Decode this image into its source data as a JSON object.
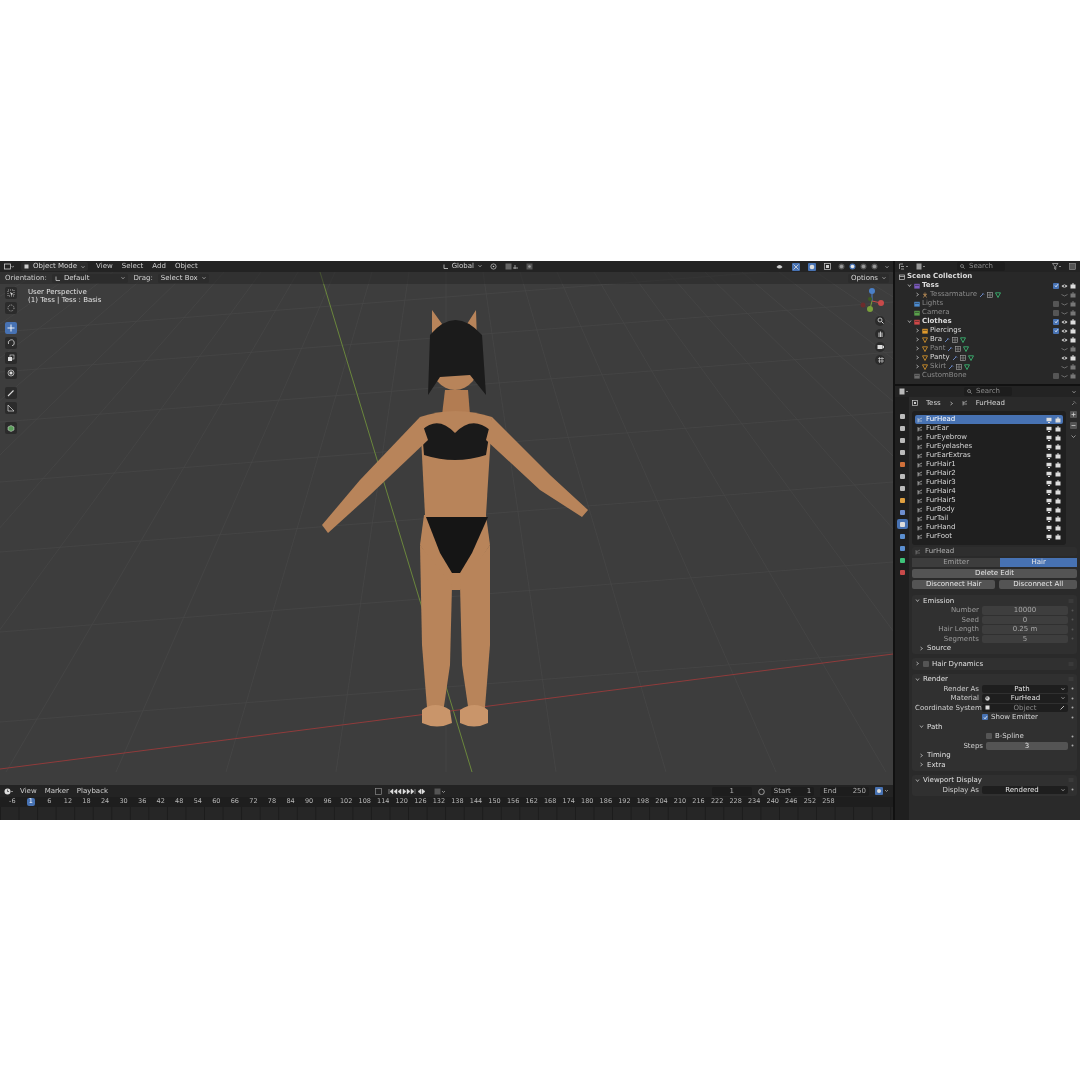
{
  "viewport": {
    "header": {
      "mode": "Object Mode",
      "menus": [
        "View",
        "Select",
        "Add",
        "Object"
      ],
      "orientation": "Global"
    },
    "tool_settings": {
      "orientation_label": "Orientation:",
      "orientation": "Default",
      "drag_label": "Drag:",
      "drag": "Select Box",
      "options": "Options"
    },
    "overlay_text": [
      "User Perspective",
      "(1) Tess | Tess : Basis"
    ],
    "tools": [
      {
        "selected": false
      },
      {
        "selected": false
      },
      {
        "selected": true
      },
      {
        "selected": false
      },
      {
        "selected": false
      },
      {
        "selected": false
      },
      {
        "selected": false
      },
      {
        "selected": false
      },
      {
        "selected": false
      }
    ],
    "shading_modes": [
      {
        "selected": false
      },
      {
        "selected": true
      },
      {
        "selected": false
      },
      {
        "selected": false
      }
    ]
  },
  "timeline": {
    "menus": [
      "View",
      "Marker",
      "Playback"
    ],
    "current_frame": "1",
    "start_label": "Start",
    "start": "1",
    "end_label": "End",
    "end": "250",
    "ruler": [
      {
        "label": "-6",
        "selected": false
      },
      {
        "label": "1",
        "selected": true
      },
      {
        "label": "6",
        "selected": false
      },
      {
        "label": "12",
        "selected": false
      },
      {
        "label": "18",
        "selected": false
      },
      {
        "label": "24",
        "selected": false
      },
      {
        "label": "30",
        "selected": false
      },
      {
        "label": "36",
        "selected": false
      },
      {
        "label": "42",
        "selected": false
      },
      {
        "label": "48",
        "selected": false
      },
      {
        "label": "54",
        "selected": false
      },
      {
        "label": "60",
        "selected": false
      },
      {
        "label": "66",
        "selected": false
      },
      {
        "label": "72",
        "selected": false
      },
      {
        "label": "78",
        "selected": false
      },
      {
        "label": "84",
        "selected": false
      },
      {
        "label": "90",
        "selected": false
      },
      {
        "label": "96",
        "selected": false
      },
      {
        "label": "102",
        "selected": false
      },
      {
        "label": "108",
        "selected": false
      },
      {
        "label": "114",
        "selected": false
      },
      {
        "label": "120",
        "selected": false
      },
      {
        "label": "126",
        "selected": false
      },
      {
        "label": "132",
        "selected": false
      },
      {
        "label": "138",
        "selected": false
      },
      {
        "label": "144",
        "selected": false
      },
      {
        "label": "150",
        "selected": false
      },
      {
        "label": "156",
        "selected": false
      },
      {
        "label": "162",
        "selected": false
      },
      {
        "label": "168",
        "selected": false
      },
      {
        "label": "174",
        "selected": false
      },
      {
        "label": "180",
        "selected": false
      },
      {
        "label": "186",
        "selected": false
      },
      {
        "label": "192",
        "selected": false
      },
      {
        "label": "198",
        "selected": false
      },
      {
        "label": "204",
        "selected": false
      },
      {
        "label": "210",
        "selected": false
      },
      {
        "label": "216",
        "selected": false
      },
      {
        "label": "222",
        "selected": false
      },
      {
        "label": "228",
        "selected": false
      },
      {
        "label": "234",
        "selected": false
      },
      {
        "label": "240",
        "selected": false
      },
      {
        "label": "246",
        "selected": false
      },
      {
        "label": "252",
        "selected": false
      },
      {
        "label": "258",
        "selected": false
      }
    ]
  },
  "outliner": {
    "search_placeholder": "Search",
    "items": [
      {
        "label": "Scene Collection",
        "kind": "scene",
        "children": [
          {
            "label": "Tess",
            "kind": "collection",
            "color": "#7d5bbf",
            "expanded": true,
            "checked": true,
            "visible": true,
            "children": [
              {
                "label": "Tessarmature",
                "kind": "armature",
                "expanded": false,
                "visible": false
              }
            ]
          },
          {
            "label": "Lights",
            "kind": "collection",
            "color": "#4c8cd1",
            "checked": false,
            "visible": false
          },
          {
            "label": "Camera",
            "kind": "collection",
            "color": "#5aa14b",
            "checked": false,
            "visible": false
          },
          {
            "label": "Clothes",
            "kind": "collection",
            "color": "#d04848",
            "expanded": true,
            "checked": true,
            "visible": true,
            "children": [
              {
                "label": "Piercings",
                "kind": "collection",
                "color": "#e09a2c",
                "expanded": false,
                "checked": true,
                "visible": true
              },
              {
                "label": "Bra",
                "kind": "mesh",
                "expanded": false,
                "visible": true
              },
              {
                "label": "Pant",
                "kind": "mesh",
                "expanded": false,
                "visible": false
              },
              {
                "label": "Panty",
                "kind": "mesh",
                "expanded": false,
                "visible": true
              },
              {
                "label": "Skirt",
                "kind": "mesh",
                "expanded": false,
                "visible": false
              }
            ]
          },
          {
            "label": "CustomBone",
            "kind": "collection",
            "color": "#6b6b6b",
            "checked": false,
            "visible": false
          }
        ]
      }
    ]
  },
  "properties": {
    "search_placeholder": "Search",
    "breadcrumb": [
      "Tess",
      "FurHead"
    ],
    "tabs": [
      {
        "selected": false
      },
      {
        "selected": false
      },
      {
        "selected": false
      },
      {
        "selected": false
      },
      {
        "selected": false
      },
      {
        "selected": false
      },
      {
        "selected": false
      },
      {
        "selected": false
      },
      {
        "selected": false
      },
      {
        "selected": true
      },
      {
        "selected": false
      },
      {
        "selected": false
      },
      {
        "selected": false
      },
      {
        "selected": false
      }
    ],
    "particle_systems": [
      {
        "label": "FurHead",
        "selected": true
      },
      {
        "label": "FurEar",
        "selected": false
      },
      {
        "label": "FurEyebrow",
        "selected": false
      },
      {
        "label": "FurEyelashes",
        "selected": false
      },
      {
        "label": "FurEarExtras",
        "selected": false
      },
      {
        "label": "FurHair1",
        "selected": false
      },
      {
        "label": "FurHair2",
        "selected": false
      },
      {
        "label": "FurHair3",
        "selected": false
      },
      {
        "label": "FurHair4",
        "selected": false
      },
      {
        "label": "FurHair5",
        "selected": false
      },
      {
        "label": "FurBody",
        "selected": false
      },
      {
        "label": "FurTail",
        "selected": false
      },
      {
        "label": "FurHand",
        "selected": false
      },
      {
        "label": "FurFoot",
        "selected": false
      }
    ],
    "name": "FurHead",
    "type_tabs": [
      {
        "label": "Emitter",
        "selected": false
      },
      {
        "label": "Hair",
        "selected": true
      }
    ],
    "delete_button": "Delete Edit",
    "disconnect_buttons": [
      "Disconnect Hair",
      "Disconnect All"
    ],
    "panels": [
      {
        "title": "Emission",
        "expanded": true,
        "fields": [
          {
            "kind": "number",
            "label": "Number",
            "value": "10000",
            "disabled": true
          },
          {
            "kind": "number",
            "label": "Seed",
            "value": "0",
            "disabled": true
          },
          {
            "kind": "number",
            "label": "Hair Length",
            "value": "0.25 m",
            "disabled": true
          },
          {
            "kind": "number",
            "label": "Segments",
            "value": "5",
            "disabled": true
          }
        ],
        "subpanels": [
          {
            "title": "Source",
            "expanded": false
          }
        ]
      },
      {
        "title": "Hair Dynamics",
        "expanded": false,
        "enabled": false
      },
      {
        "title": "Render",
        "expanded": true,
        "fields": [
          {
            "kind": "dropdown",
            "label": "Render As",
            "value": "Path",
            "disabled": false
          },
          {
            "kind": "material",
            "label": "Material",
            "value": "FurHead",
            "disabled": false
          },
          {
            "kind": "object",
            "label": "Coordinate System",
            "placeholder": "Object",
            "disabled": false
          },
          {
            "kind": "checkbox",
            "label": "Show Emitter",
            "checked": true
          }
        ],
        "subpanels": [
          {
            "title": "Path",
            "expanded": true,
            "fields": [
              {
                "kind": "checkbox",
                "label": "B-Spline",
                "checked": false
              },
              {
                "kind": "number",
                "label": "Steps",
                "value": "3",
                "disabled": false
              }
            ]
          },
          {
            "title": "Timing",
            "expanded": false
          },
          {
            "title": "Extra",
            "expanded": false
          }
        ]
      },
      {
        "title": "Viewport Display",
        "expanded": true,
        "fields": [
          {
            "kind": "dropdown",
            "label": "Display As",
            "value": "Rendered",
            "disabled": false
          }
        ]
      }
    ]
  }
}
